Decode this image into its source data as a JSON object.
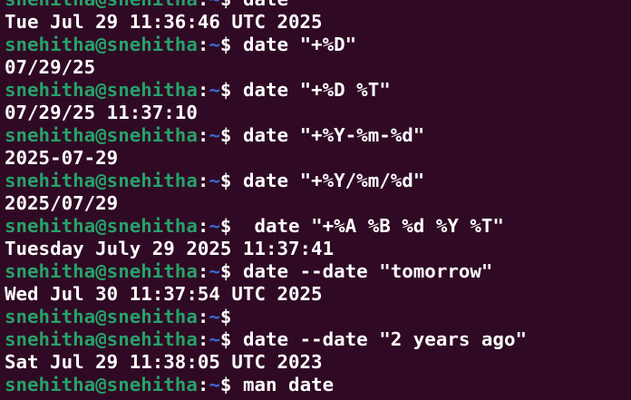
{
  "theme": {
    "background": "#300a24",
    "user_color": "#26a269",
    "path_color": "#3a6ad6",
    "text_color": "#ffffff"
  },
  "lines": [
    {
      "type": "prompt",
      "user": "snehitha@snehitha",
      "path": "~",
      "symbol": "$",
      "command": " date"
    },
    {
      "type": "output",
      "text": "Tue Jul 29 11:36:46 UTC 2025"
    },
    {
      "type": "prompt",
      "user": "snehitha@snehitha",
      "path": "~",
      "symbol": "$",
      "command": " date \"+%D\""
    },
    {
      "type": "output",
      "text": "07/29/25"
    },
    {
      "type": "prompt",
      "user": "snehitha@snehitha",
      "path": "~",
      "symbol": "$",
      "command": " date \"+%D %T\""
    },
    {
      "type": "output",
      "text": "07/29/25 11:37:10"
    },
    {
      "type": "prompt",
      "user": "snehitha@snehitha",
      "path": "~",
      "symbol": "$",
      "command": " date \"+%Y-%m-%d\""
    },
    {
      "type": "output",
      "text": "2025-07-29"
    },
    {
      "type": "prompt",
      "user": "snehitha@snehitha",
      "path": "~",
      "symbol": "$",
      "command": " date \"+%Y/%m/%d\""
    },
    {
      "type": "output",
      "text": "2025/07/29"
    },
    {
      "type": "prompt",
      "user": "snehitha@snehitha",
      "path": "~",
      "symbol": "$",
      "command": "  date \"+%A %B %d %Y %T\""
    },
    {
      "type": "output",
      "text": "Tuesday July 29 2025 11:37:41"
    },
    {
      "type": "prompt",
      "user": "snehitha@snehitha",
      "path": "~",
      "symbol": "$",
      "command": " date --date \"tomorrow\""
    },
    {
      "type": "output",
      "text": "Wed Jul 30 11:37:54 UTC 2025"
    },
    {
      "type": "prompt",
      "user": "snehitha@snehitha",
      "path": "~",
      "symbol": "$",
      "command": ""
    },
    {
      "type": "prompt",
      "user": "snehitha@snehitha",
      "path": "~",
      "symbol": "$",
      "command": " date --date \"2 years ago\""
    },
    {
      "type": "output",
      "text": "Sat Jul 29 11:38:05 UTC 2023"
    },
    {
      "type": "prompt",
      "user": "snehitha@snehitha",
      "path": "~",
      "symbol": "$",
      "command": " man date"
    }
  ]
}
